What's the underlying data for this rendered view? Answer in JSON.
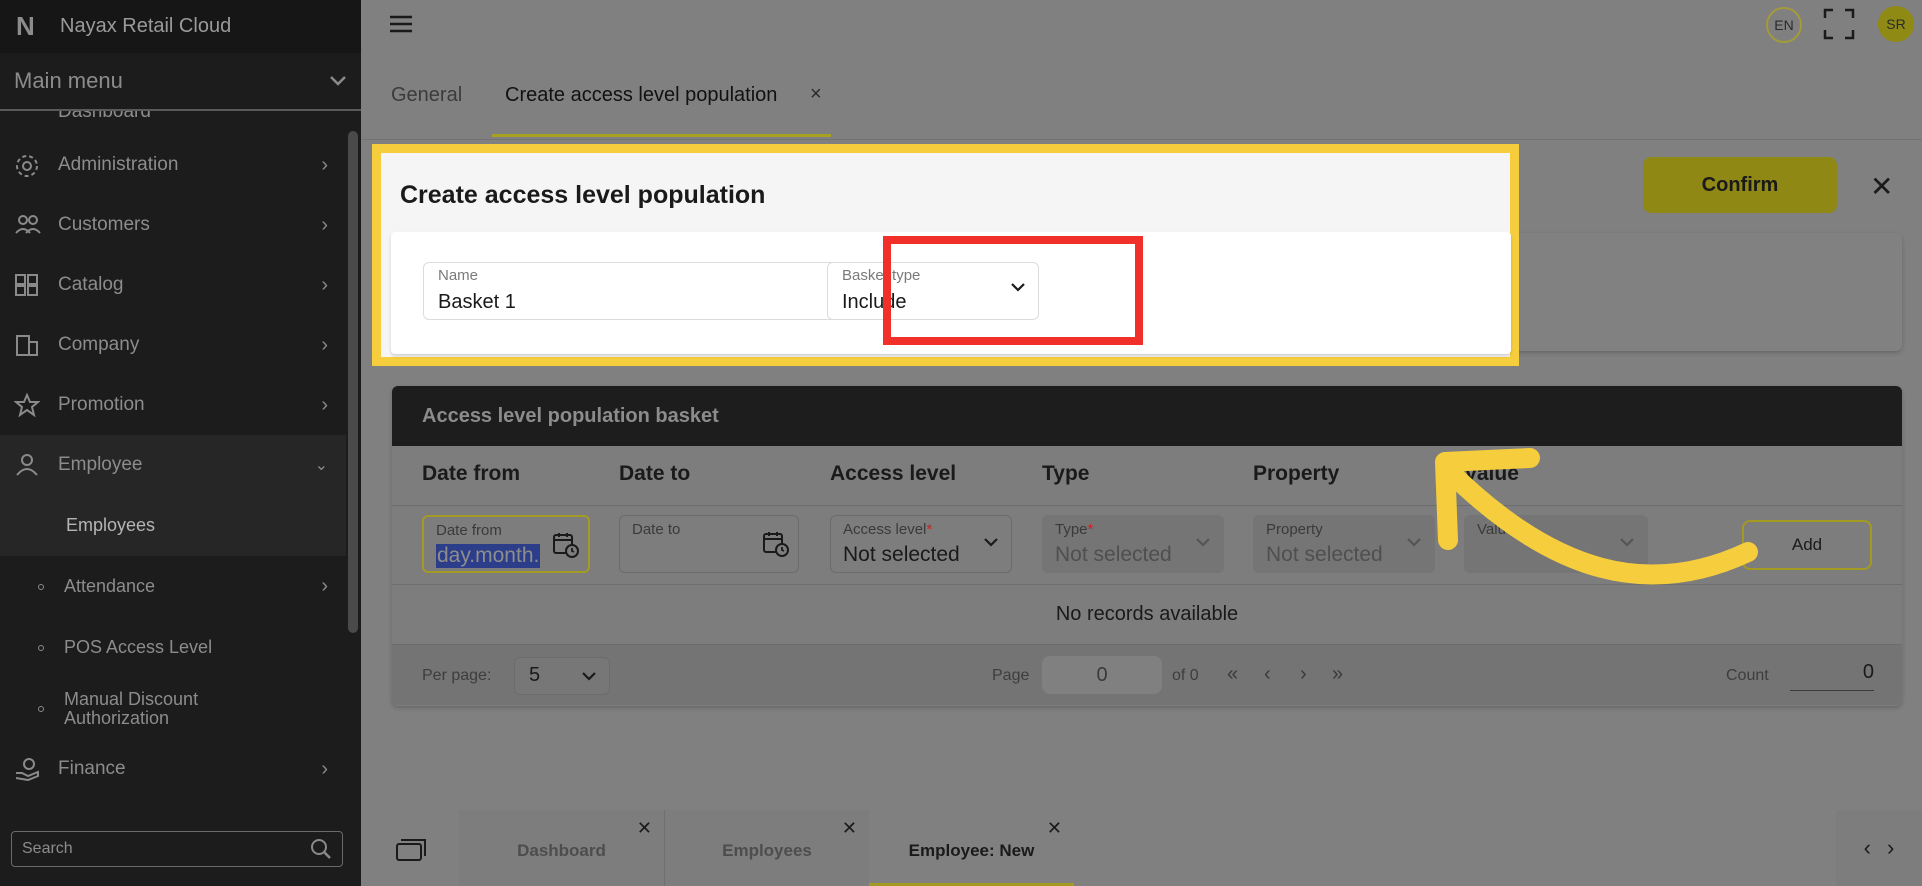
{
  "app": {
    "brand_name": "Nayax Retail Cloud",
    "language": "EN",
    "user_initials": "SR"
  },
  "sidebar": {
    "main_menu_label": "Main menu",
    "partial_item": "Dashboard",
    "items": [
      {
        "label": "Administration"
      },
      {
        "label": "Customers"
      },
      {
        "label": "Catalog"
      },
      {
        "label": "Company"
      },
      {
        "label": "Promotion"
      },
      {
        "label": "Employee"
      }
    ],
    "subitems": [
      {
        "label": "Employees"
      },
      {
        "label": "Attendance"
      },
      {
        "label": "POS Access Level"
      },
      {
        "label": "Manual Discount Authorization"
      }
    ],
    "finance_label": "Finance",
    "search_placeholder": "Search"
  },
  "tabs": {
    "general": "General",
    "create": "Create access level population",
    "close_symbol": "×"
  },
  "form": {
    "title": "Create access level population",
    "confirm_label": "Confirm",
    "close_symbol": "✕",
    "name_label": "Name",
    "name_value": "Basket 1",
    "basket_type_label": "Basket type",
    "basket_type_value": "Include"
  },
  "basket": {
    "title": "Access level population basket",
    "columns": [
      "Date from",
      "Date to",
      "Access level",
      "Type",
      "Property",
      "Value"
    ],
    "filters": {
      "date_from_label": "Date from",
      "date_from_value": "day.month.",
      "date_to_label": "Date to",
      "access_level_label": "Access level",
      "access_level_value": "Not selected",
      "type_label": "Type",
      "type_value": "Not selected",
      "property_label": "Property",
      "property_value": "Not selected",
      "value_label": "Value",
      "required_mark": "*"
    },
    "add_label": "Add",
    "empty_text": "No records available",
    "pager": {
      "per_page_label": "Per page:",
      "per_page_value": "5",
      "page_label": "Page",
      "page_value": "0",
      "of_text": "of 0",
      "count_label": "Count",
      "count_value": "0"
    }
  },
  "window_tabs": [
    {
      "label": "Dashboard"
    },
    {
      "label": "Employees"
    },
    {
      "label": "Employee: New"
    }
  ],
  "colors": {
    "highlight_yellow": "#f6cd3d",
    "highlight_red": "#f2302a",
    "accent": "#908815"
  }
}
